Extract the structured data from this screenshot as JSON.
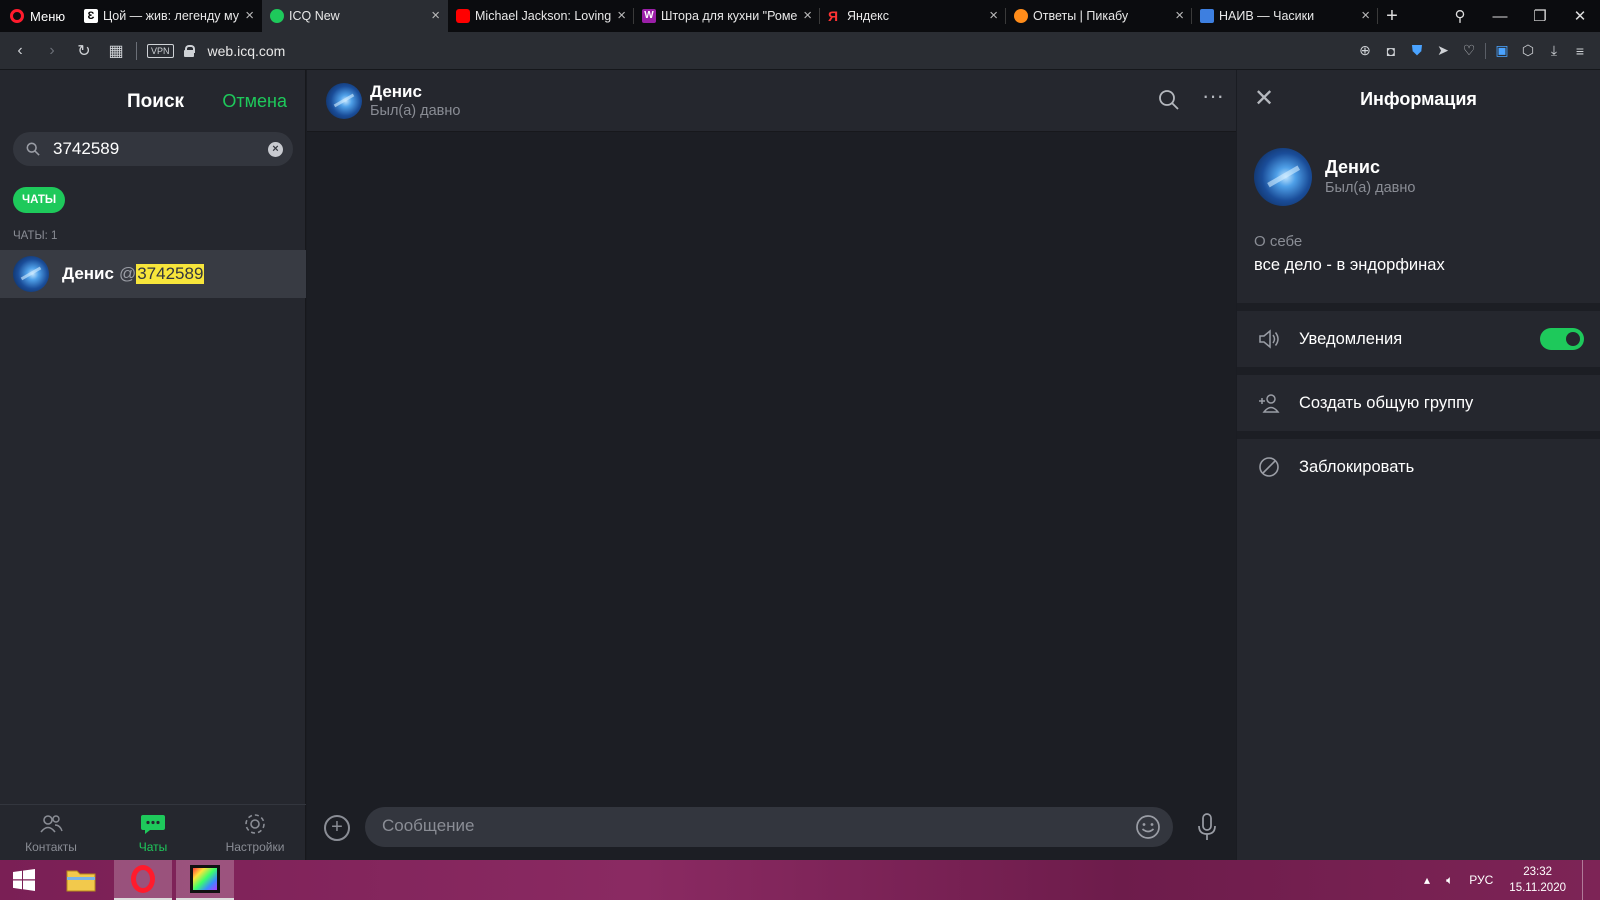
{
  "browser": {
    "menu_label": "Меню",
    "tabs": [
      {
        "title": "Цой — жив: легенду му",
        "favicon_color": "#ffffff",
        "active": false
      },
      {
        "title": "ICQ New",
        "favicon_color": "#1ec95b",
        "active": true
      },
      {
        "title": "Michael Jackson: Loving",
        "favicon_color": "#ff0000",
        "active": false
      },
      {
        "title": "Штора для кухни \"Роме",
        "favicon_color": "#9b1fa8",
        "active": false
      },
      {
        "title": "Яндекс",
        "favicon_color": "#ff3333",
        "active": false
      },
      {
        "title": "Ответы | Пикабу",
        "favicon_color": "#ff8c1a",
        "active": false
      },
      {
        "title": "НАИВ — Часики",
        "favicon_color": "#3d7fe0",
        "active": false
      }
    ],
    "address": {
      "vpn_label": "VPN",
      "url": "web.icq.com"
    }
  },
  "left_panel": {
    "title": "Поиск",
    "cancel_label": "Отмена",
    "search": {
      "value": "3742589",
      "placeholder": ""
    },
    "filter_chip": "ЧАТЫ",
    "results_count_label": "ЧАТЫ: 1",
    "results": [
      {
        "name": "Денис",
        "at": "@",
        "highlight": "3742589"
      }
    ],
    "bottom_nav": [
      {
        "label": "Контакты",
        "icon": "contacts-icon",
        "active": false
      },
      {
        "label": "Чаты",
        "icon": "chats-icon",
        "active": true
      },
      {
        "label": "Настройки",
        "icon": "settings-gear-icon",
        "active": false
      }
    ]
  },
  "chat": {
    "name": "Денис",
    "status": "Был(а) давно",
    "composer_placeholder": "Сообщение"
  },
  "info_panel": {
    "title": "Информация",
    "name": "Денис",
    "status": "Был(а) давно",
    "about_label": "О себе",
    "about_text": "все дело - в эндорфинах",
    "notifications_label": "Уведомления",
    "notifications_on": true,
    "create_group_label": "Создать общую группу",
    "block_label": "Заблокировать"
  },
  "taskbar": {
    "language": "РУС",
    "time": "23:32",
    "date": "15.11.2020"
  },
  "colors": {
    "accent": "#1ec95b",
    "highlight": "#f7e53b",
    "panel": "#25272e",
    "chat_bg": "#1c1e24"
  }
}
